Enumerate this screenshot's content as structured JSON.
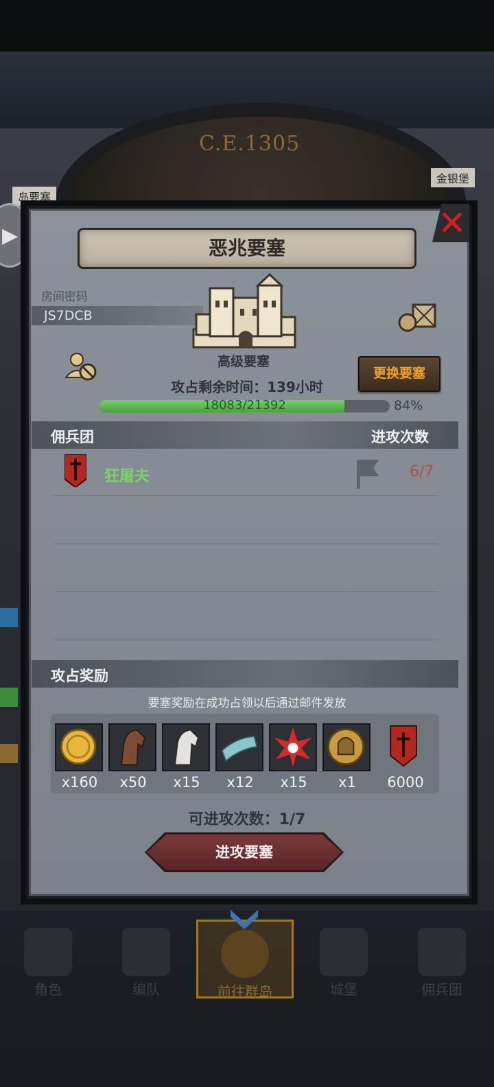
{
  "background": {
    "era": "C.E.1305",
    "map_tags": [
      "岛要塞",
      "金银堡"
    ]
  },
  "dialog": {
    "title": "恶兆要塞",
    "room_label": "房间密码",
    "room_code": "JS7DCB",
    "fortress_name": "高级要塞",
    "change_button": "更换要塞",
    "time_remaining": "攻占剩余时间：139小时",
    "progress": {
      "current_text": "18083/21392",
      "percent_text": "84%",
      "fraction": 0.845
    },
    "merc_header": {
      "title": "佣兵团",
      "attack_count_label": "进攻次数"
    },
    "mercenaries": [
      {
        "name": "狂屠夫",
        "count": "6/7"
      }
    ],
    "reward_header": "攻占奖励",
    "reward_note": "要塞奖励在成功占领以后通过邮件发放",
    "rewards": [
      {
        "icon": "gold-coin-icon",
        "qty": "x160"
      },
      {
        "icon": "brown-horse-icon",
        "qty": "x50"
      },
      {
        "icon": "white-horse-icon",
        "qty": "x15"
      },
      {
        "icon": "cloth-icon",
        "qty": "x12"
      },
      {
        "icon": "red-star-icon",
        "qty": "x15"
      },
      {
        "icon": "knight-helmet-coin-icon",
        "qty": "x1"
      },
      {
        "icon": "guild-banner-icon",
        "qty": "6000"
      }
    ],
    "attempts": "可进攻次数：1/7",
    "attack_button": "进攻要塞"
  },
  "bottom_nav": [
    {
      "label": "角色"
    },
    {
      "label": "编队"
    },
    {
      "label": "前往群岛",
      "active": true
    },
    {
      "label": "城堡"
    },
    {
      "label": "佣兵团"
    }
  ],
  "colors": {
    "accent_orange": "#f0a024",
    "merc_green": "#7ad26c",
    "count_red": "#b0504e",
    "close_red": "#d21f1f"
  }
}
